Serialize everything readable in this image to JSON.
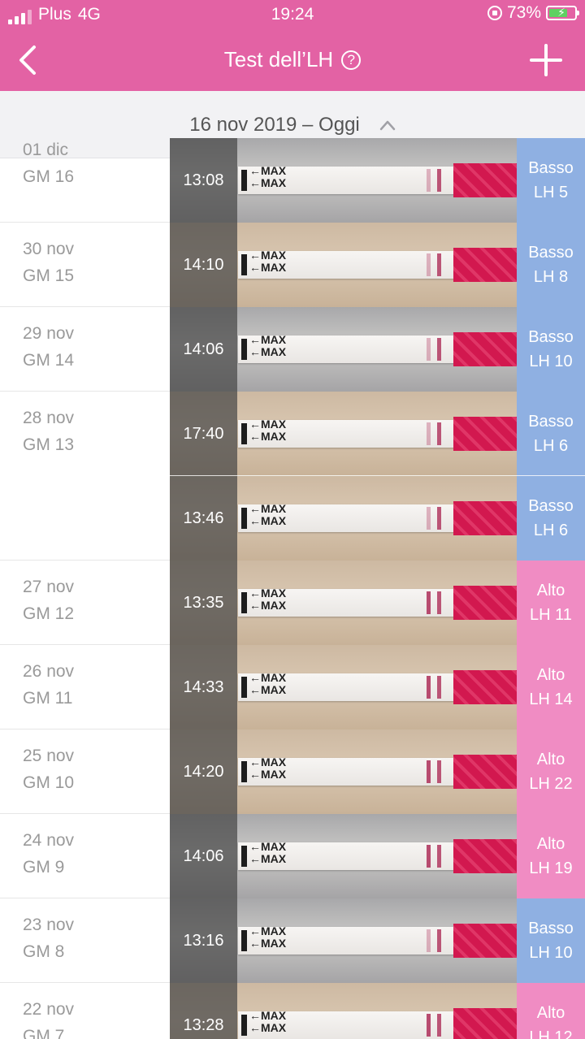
{
  "status_bar": {
    "carrier": "Plus",
    "network": "4G",
    "time": "19:24",
    "battery": "73%",
    "battery_fill": 0.73
  },
  "nav": {
    "title": "Test dell’LH",
    "help_glyph": "?"
  },
  "range": {
    "label": "16 nov 2019 – Oggi"
  },
  "colors": {
    "header": "#e362a4",
    "low": "#8fb0e2",
    "high": "#f08cc3"
  },
  "days": [
    {
      "date": "01 dic",
      "gm": "GM 16",
      "entries": [
        {
          "time": "13:08",
          "result": "Basso",
          "lh": "LH 5",
          "level": "low"
        }
      ]
    },
    {
      "date": "30 nov",
      "gm": "GM 15",
      "entries": [
        {
          "time": "14:10",
          "result": "Basso",
          "lh": "LH 8",
          "level": "low"
        }
      ]
    },
    {
      "date": "29 nov",
      "gm": "GM 14",
      "entries": [
        {
          "time": "14:06",
          "result": "Basso",
          "lh": "LH 10",
          "level": "low"
        }
      ]
    },
    {
      "date": "28 nov",
      "gm": "GM 13",
      "entries": [
        {
          "time": "17:40",
          "result": "Basso",
          "lh": "LH 6",
          "level": "low"
        },
        {
          "time": "13:46",
          "result": "Basso",
          "lh": "LH 6",
          "level": "low"
        }
      ]
    },
    {
      "date": "27 nov",
      "gm": "GM 12",
      "entries": [
        {
          "time": "13:35",
          "result": "Alto",
          "lh": "LH 11",
          "level": "high"
        }
      ]
    },
    {
      "date": "26 nov",
      "gm": "GM 11",
      "entries": [
        {
          "time": "14:33",
          "result": "Alto",
          "lh": "LH 14",
          "level": "high"
        }
      ]
    },
    {
      "date": "25 nov",
      "gm": "GM 10",
      "entries": [
        {
          "time": "14:20",
          "result": "Alto",
          "lh": "LH 22",
          "level": "high"
        }
      ]
    },
    {
      "date": "24 nov",
      "gm": "GM 9",
      "entries": [
        {
          "time": "14:06",
          "result": "Alto",
          "lh": "LH 19",
          "level": "high"
        }
      ]
    },
    {
      "date": "23 nov",
      "gm": "GM 8",
      "entries": [
        {
          "time": "13:16",
          "result": "Basso",
          "lh": "LH 10",
          "level": "low"
        }
      ]
    },
    {
      "date": "22 nov",
      "gm": "GM 7",
      "entries": [
        {
          "time": "13:28",
          "result": "Alto",
          "lh": "LH 12",
          "level": "high"
        }
      ]
    }
  ],
  "strip_text": "MAX"
}
